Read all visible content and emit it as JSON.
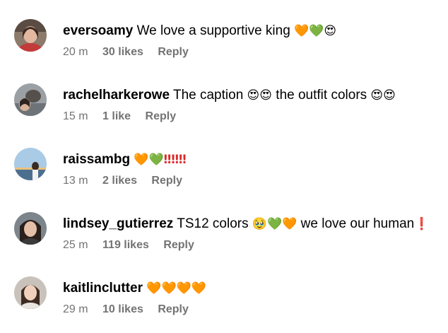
{
  "comments": [
    {
      "username": "eversoamy",
      "text": "We love a supportive king",
      "emojis": [
        "🧡",
        "💚",
        "😍"
      ],
      "time": "20 m",
      "likes": "30 likes",
      "reply": "Reply"
    },
    {
      "username": "rachelharkerowe",
      "text_1": "The caption",
      "emojis_1": [
        "😍",
        "😍"
      ],
      "text_2": "the outfit colors",
      "emojis_2": [
        "😍",
        "😍"
      ],
      "time": "15 m",
      "likes": "1 like",
      "reply": "Reply"
    },
    {
      "username": "raissambg",
      "emojis": [
        "🧡",
        "💚"
      ],
      "bangs": "‼‼‼",
      "time": "13 m",
      "likes": "2 likes",
      "reply": "Reply"
    },
    {
      "username": "lindsey_gutierrez",
      "text_1": "TS12 colors",
      "emojis": [
        "🥹",
        "💚",
        "🧡"
      ],
      "text_2": "we love our human",
      "bang": "❗",
      "time": "25 m",
      "likes": "119 likes",
      "reply": "Reply"
    },
    {
      "username": "kaitlinclutter",
      "emojis": [
        "🧡",
        "🧡",
        "🧡",
        "🧡"
      ],
      "time": "29 m",
      "likes": "10 likes",
      "reply": "Reply"
    }
  ]
}
